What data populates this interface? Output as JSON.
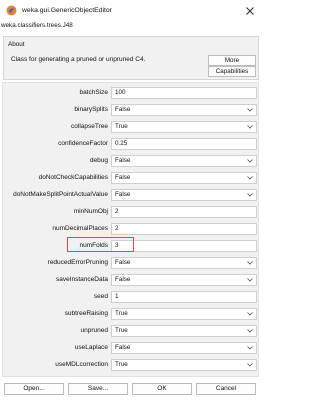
{
  "window": {
    "title": "weka.gui.GenericObjectEditor",
    "class_path": "weka.classifiers.trees.J48"
  },
  "about": {
    "legend": "About",
    "description": "Class for generating a pruned or unpruned C4.",
    "more_label": "More",
    "capabilities_label": "Capabilities"
  },
  "properties": [
    {
      "name": "batchSize",
      "value": "100",
      "type": "text"
    },
    {
      "name": "binarySplits",
      "value": "False",
      "type": "select"
    },
    {
      "name": "collapseTree",
      "value": "True",
      "type": "select"
    },
    {
      "name": "confidenceFactor",
      "value": "0.25",
      "type": "text"
    },
    {
      "name": "debug",
      "value": "False",
      "type": "select"
    },
    {
      "name": "doNotCheckCapabilities",
      "value": "False",
      "type": "select"
    },
    {
      "name": "doNotMakeSplitPointActualValue",
      "value": "False",
      "type": "select"
    },
    {
      "name": "minNumObj",
      "value": "2",
      "type": "text"
    },
    {
      "name": "numDecimalPlaces",
      "value": "2",
      "type": "text"
    },
    {
      "name": "numFolds",
      "value": "3",
      "type": "text"
    },
    {
      "name": "reducedErrorPruning",
      "value": "False",
      "type": "select"
    },
    {
      "name": "saveInstanceData",
      "value": "False",
      "type": "select"
    },
    {
      "name": "seed",
      "value": "1",
      "type": "text"
    },
    {
      "name": "subtreeRaising",
      "value": "True",
      "type": "select"
    },
    {
      "name": "unpruned",
      "value": "True",
      "type": "select"
    },
    {
      "name": "useLaplace",
      "value": "False",
      "type": "select"
    },
    {
      "name": "useMDLcorrection",
      "value": "True",
      "type": "select"
    }
  ],
  "buttons": {
    "open": "Open...",
    "save": "Save...",
    "ok": "OK",
    "cancel": "Cancel"
  },
  "colors": {
    "highlight": "#e04848",
    "panel": "#f1f1f1",
    "icon_orange": "#e8823a",
    "icon_blue": "#3b6fb6"
  }
}
